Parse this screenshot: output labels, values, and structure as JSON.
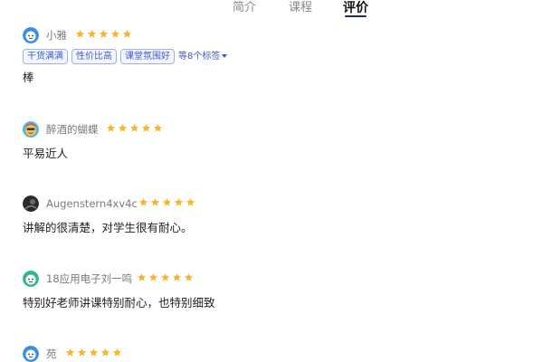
{
  "tabs": [
    {
      "label": "简介"
    },
    {
      "label": "课程"
    },
    {
      "label": "评价",
      "active": true
    }
  ],
  "colors": {
    "star": "#f7b52c",
    "tag_text": "#3d5ccc",
    "tag_border": "#9fb0e6",
    "active_tab_underline": "#1e2a6b"
  },
  "reviews": [
    {
      "username": "小雅",
      "avatar_icon": "blue-smiley-avatar-icon",
      "rating": 5,
      "tags": [
        "干货满满",
        "性价比高",
        "课堂氛围好"
      ],
      "more_tags_label": "等8个标签",
      "text": "棒"
    },
    {
      "username": "醉酒的蝴蝶",
      "avatar_icon": "cartoon-face-avatar-icon",
      "rating": 5,
      "text": "平易近人"
    },
    {
      "username": "Augenstern4xv4c",
      "avatar_icon": "dark-photo-avatar-icon",
      "rating": 5,
      "text": "讲解的很清楚，对学生很有耐心。"
    },
    {
      "username": "18应用电子刘一鸣",
      "avatar_icon": "green-smiley-avatar-icon",
      "rating": 5,
      "text": "特别好老师讲课特别耐心，也特别细致"
    },
    {
      "username": "苑",
      "avatar_icon": "blue-smiley-avatar-icon",
      "rating": 5,
      "text": ""
    }
  ]
}
